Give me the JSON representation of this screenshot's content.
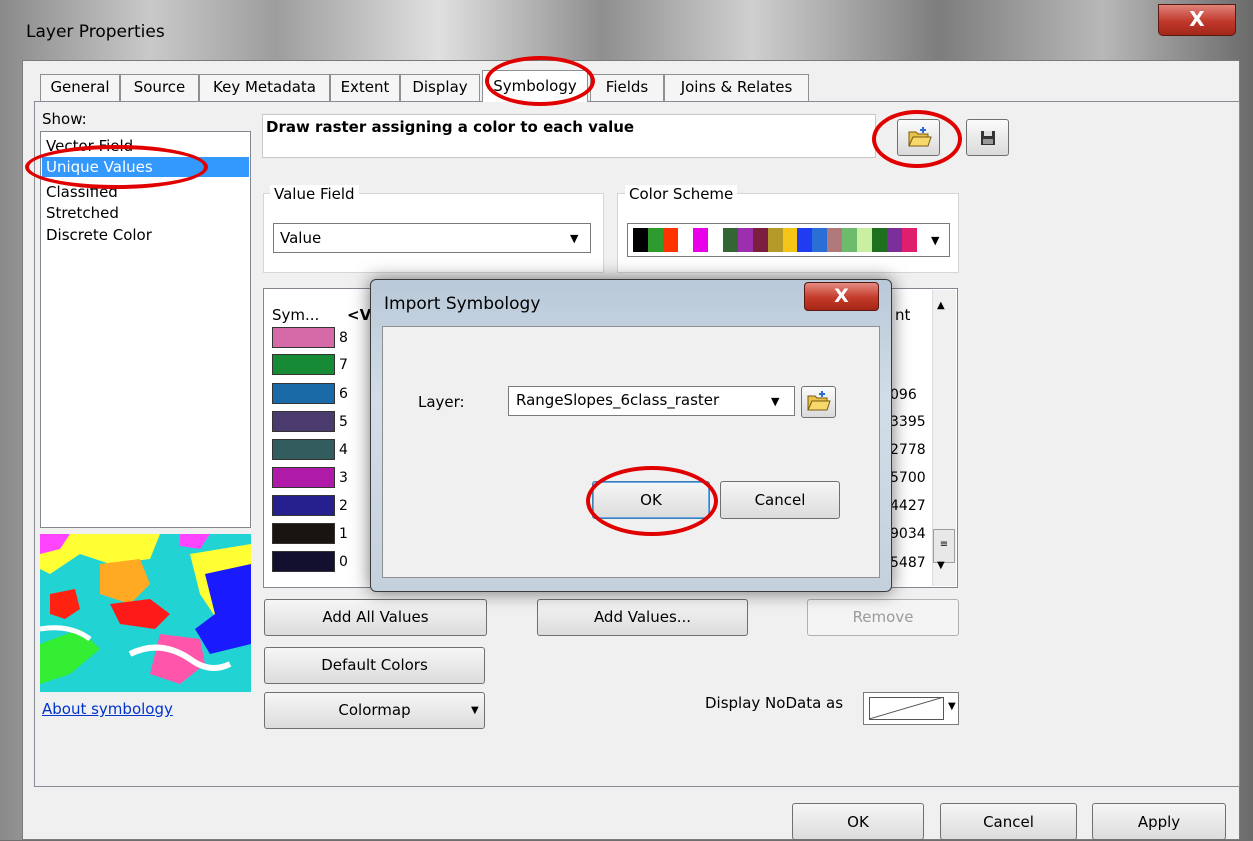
{
  "window": {
    "title": "Layer Properties",
    "close_glyph": "X"
  },
  "tabs": [
    {
      "label": "General"
    },
    {
      "label": "Source"
    },
    {
      "label": "Key Metadata"
    },
    {
      "label": "Extent"
    },
    {
      "label": "Display"
    },
    {
      "label": "Symbology"
    },
    {
      "label": "Fields"
    },
    {
      "label": "Joins & Relates"
    }
  ],
  "active_tab": "Symbology",
  "show": {
    "label": "Show:",
    "items": [
      {
        "label": "Vector Field"
      },
      {
        "label": "Unique Values"
      },
      {
        "label": "Classified"
      },
      {
        "label": "Stretched"
      },
      {
        "label": "Discrete Color"
      }
    ],
    "selected": "Unique Values"
  },
  "about_link": "About symbology",
  "description": "Draw raster assigning a color to each value",
  "icons": {
    "import": "folder-import-icon",
    "save": "save-disk-icon"
  },
  "value_field": {
    "label": "Value Field",
    "value": "Value"
  },
  "color_scheme": {
    "label": "Color Scheme",
    "colors": [
      "#000000",
      "#2e9b2e",
      "#ff3300",
      "#ffffff",
      "#e800e8",
      "#ffffff",
      "#336633",
      "#9b2fae",
      "#7a1f3d",
      "#b59a2a",
      "#f5c518",
      "#1f3cf0",
      "#2a6fd6",
      "#b07a7a",
      "#6dbb6d",
      "#c8f0a0",
      "#1e6f1e",
      "#7a2f9b",
      "#e01e6e"
    ]
  },
  "table": {
    "col_symbol": "Sym...",
    "col_value": "<V",
    "col_count": "nt",
    "rows": [
      {
        "value": "8",
        "color": "#d66aa8",
        "count": ""
      },
      {
        "value": "7",
        "color": "#178a35",
        "count": ""
      },
      {
        "value": "6",
        "color": "#1a6aa8",
        "count": "096"
      },
      {
        "value": "5",
        "color": "#4b3a6e",
        "count": "3395"
      },
      {
        "value": "4",
        "color": "#335c5e",
        "count": "2778"
      },
      {
        "value": "3",
        "color": "#b01aa8",
        "count": "5700"
      },
      {
        "value": "2",
        "color": "#25208e",
        "count": "4427"
      },
      {
        "value": "1",
        "color": "#1a1411",
        "count": "9034"
      },
      {
        "value": "0",
        "color": "#12102e",
        "count": "5487"
      }
    ]
  },
  "buttons": {
    "add_all_values": "Add All Values",
    "add_values": "Add Values...",
    "remove": "Remove",
    "default_colors": "Default Colors",
    "colormap": "Colormap",
    "ok": "OK",
    "cancel": "Cancel",
    "apply": "Apply"
  },
  "nodata_label": "Display NoData as",
  "modal": {
    "title": "Import Symbology",
    "close_glyph": "X",
    "layer_label": "Layer:",
    "layer_value": "RangeSlopes_6class_raster",
    "ok": "OK",
    "cancel": "Cancel"
  },
  "annotation_color": "#e00000"
}
